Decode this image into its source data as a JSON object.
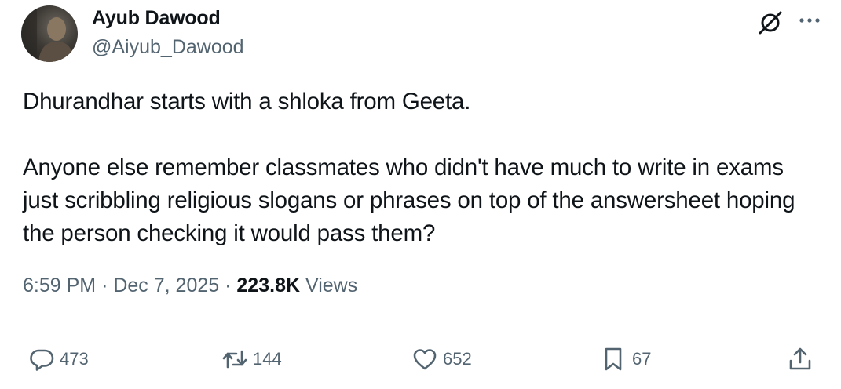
{
  "author": {
    "name": "Ayub Dawood",
    "handle": "@Aiyub_Dawood"
  },
  "header_icons": [
    "grok-icon",
    "more-icon"
  ],
  "tweet": {
    "paragraph1": "Dhurandhar starts with a shloka from Geeta.",
    "paragraph2": "Anyone else remember classmates who didn't have much to write in exams just scribbling religious slogans or phrases on top of the answersheet hoping the person checking it would pass them?"
  },
  "meta": {
    "time": "6:59 PM",
    "separator": "·",
    "date": "Dec 7, 2025",
    "views_count": "223.8K",
    "views_label": "Views"
  },
  "actions": {
    "replies": "473",
    "reposts": "144",
    "likes": "652",
    "bookmarks": "67"
  },
  "colors": {
    "text": "#0f1419",
    "secondary": "#536471",
    "divider": "#eff3f4"
  }
}
